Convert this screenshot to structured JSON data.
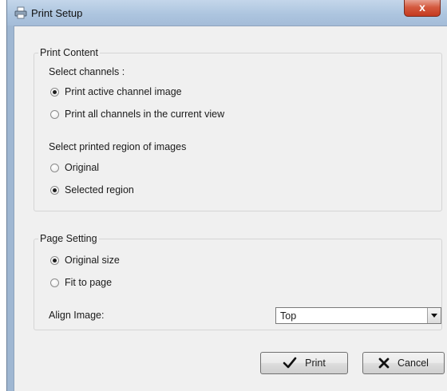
{
  "window": {
    "title": "Print Setup",
    "close_label": "x"
  },
  "print_content": {
    "legend": "Print Content",
    "channels_label": "Select channels :",
    "channel_options": [
      {
        "label": "Print active channel image",
        "checked": true
      },
      {
        "label": "Print all channels in the current view",
        "checked": false
      }
    ],
    "region_label": "Select printed region of images",
    "region_options": [
      {
        "label": "Original",
        "checked": false
      },
      {
        "label": "Selected region",
        "checked": true
      }
    ]
  },
  "page_setting": {
    "legend": "Page Setting",
    "size_options": [
      {
        "label": "Original size",
        "checked": true
      },
      {
        "label": "Fit to page",
        "checked": false
      }
    ],
    "align_label": "Align Image:",
    "align_value": "Top"
  },
  "buttons": {
    "print_label": "Print",
    "print_icon": "checkmark-icon",
    "cancel_label": "Cancel",
    "cancel_icon": "x-mark-icon"
  }
}
